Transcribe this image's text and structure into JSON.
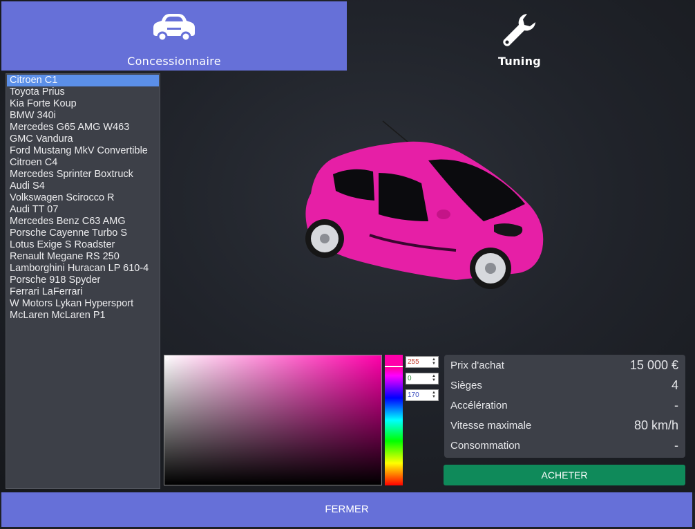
{
  "tabs": [
    {
      "label": "Concessionnaire",
      "icon": "car-icon",
      "active": true
    },
    {
      "label": "Tuning",
      "icon": "wrench-icon",
      "active": false
    }
  ],
  "vehicles": [
    "Citroen C1",
    "Toyota Prius",
    "Kia Forte Koup",
    "BMW 340i",
    "Mercedes G65 AMG W463",
    "GMC Vandura",
    "Ford Mustang MkV Convertible",
    "Citroen C4",
    "Mercedes Sprinter Boxtruck",
    "Audi S4",
    "Volkswagen Scirocco R",
    "Audi TT 07",
    "Mercedes Benz C63 AMG",
    "Porsche Cayenne Turbo S",
    "Lotus Exige S Roadster",
    "Renault Megane RS 250",
    "Lamborghini Huracan LP 610-4",
    "Porsche 918 Spyder",
    "Ferrari LaFerrari",
    "W Motors Lykan Hypersport",
    "McLaren McLaren P1"
  ],
  "selected_vehicle": "Citroen C1",
  "color": {
    "r": "255",
    "g": "0",
    "b": "170",
    "hex": "#ff00aa"
  },
  "stats": {
    "price_label": "Prix d'achat",
    "price_value": "15 000 €",
    "seats_label": "Sièges",
    "seats_value": "4",
    "accel_label": "Accélération",
    "accel_value": "-",
    "speed_label": "Vitesse maximale",
    "speed_value": "80 km/h",
    "consumption_label": "Consommation",
    "consumption_value": "-"
  },
  "buttons": {
    "buy": "ACHETER",
    "close": "FERMER"
  },
  "colors": {
    "accent": "#6670d8",
    "buy": "#0f8a5a",
    "selection": "#5b8fe8",
    "panel": "#3d4048"
  }
}
